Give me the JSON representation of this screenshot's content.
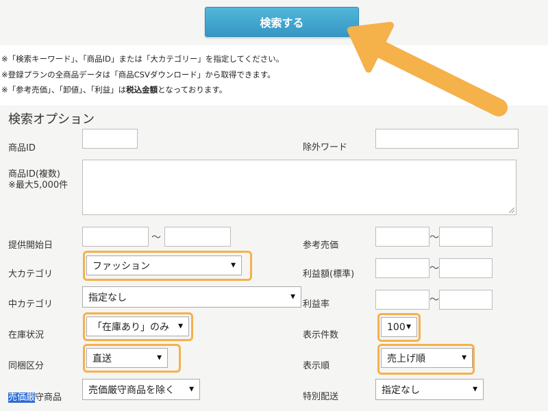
{
  "search_button": {
    "label": "検索する"
  },
  "notes": [
    "※「検索キーワード」、「商品ID」または「大カテゴリー」を指定してください。",
    "※登録プランの全商品データは「商品CSVダウンロード」から取得できます。"
  ],
  "note3": {
    "prefix": "※「参考売価」、「卸値」、「利益」は",
    "bold": "税込金額",
    "suffix": "となっております。"
  },
  "options": {
    "title": "検索オプション",
    "product_id": {
      "label": "商品ID",
      "value": ""
    },
    "exclude_word": {
      "label": "除外ワード",
      "value": ""
    },
    "multi_id": {
      "label": "商品ID(複数)",
      "sublabel": "※最大5,000件",
      "value": ""
    },
    "start_date": {
      "label": "提供開始日",
      "from": "",
      "to": ""
    },
    "ref_price": {
      "label": "参考売価",
      "from": "",
      "to": ""
    },
    "category_large": {
      "label": "大カテゴリ",
      "selected": "ファッション"
    },
    "profit_amount": {
      "label": "利益額(標準)",
      "from": "",
      "to": ""
    },
    "category_mid": {
      "label": "中カテゴリ",
      "selected": "指定なし"
    },
    "profit_rate": {
      "label": "利益率",
      "from": "",
      "to": ""
    },
    "stock": {
      "label": "在庫状況",
      "selected": "「在庫あり」のみ"
    },
    "per_page": {
      "label": "表示件数",
      "selected": "100"
    },
    "bundle": {
      "label": "同梱区分",
      "selected": "直送"
    },
    "order": {
      "label": "表示順",
      "selected": "売上げ順"
    },
    "price_guard": {
      "label_highlighted": "売価厳",
      "label_rest": "守商品",
      "selected": "売価厳守商品を除く"
    },
    "special_ship": {
      "label": "特別配送",
      "selected": "指定なし"
    },
    "tilde": "～"
  },
  "annotation": {
    "color": "#f5b14a"
  }
}
